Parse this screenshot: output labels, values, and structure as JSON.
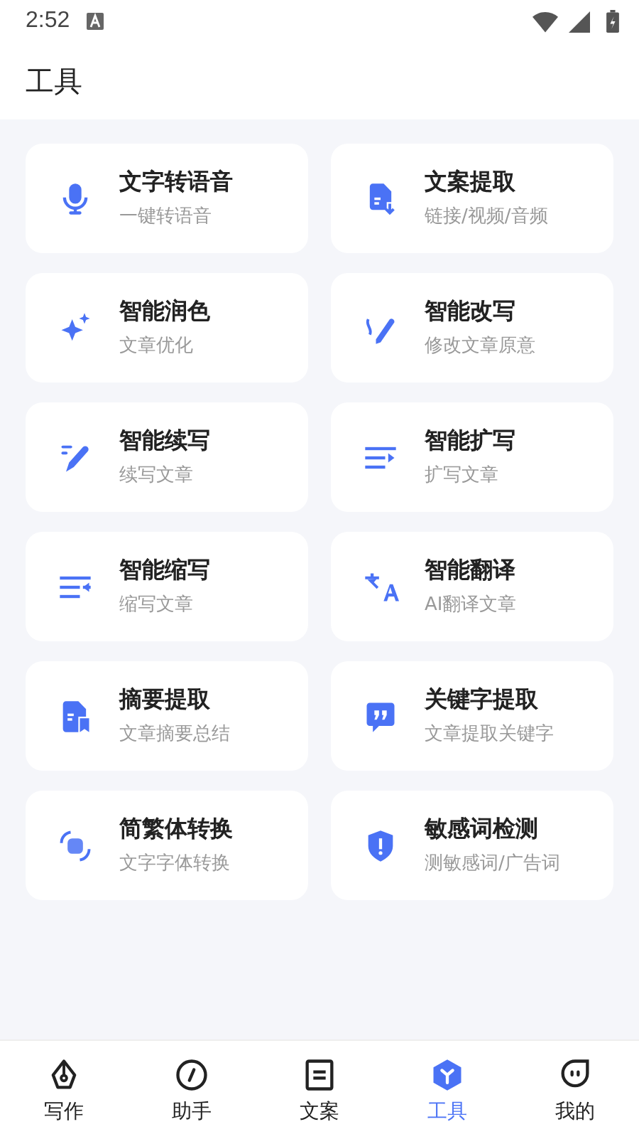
{
  "status_bar": {
    "time": "2:52"
  },
  "header": {
    "title": "工具"
  },
  "tools": [
    {
      "title": "文字转语音",
      "subtitle": "一键转语音"
    },
    {
      "title": "文案提取",
      "subtitle": "链接/视频/音频"
    },
    {
      "title": "智能润色",
      "subtitle": "文章优化"
    },
    {
      "title": "智能改写",
      "subtitle": "修改文章原意"
    },
    {
      "title": "智能续写",
      "subtitle": "续写文章"
    },
    {
      "title": "智能扩写",
      "subtitle": "扩写文章"
    },
    {
      "title": "智能缩写",
      "subtitle": "缩写文章"
    },
    {
      "title": "智能翻译",
      "subtitle": "AI翻译文章"
    },
    {
      "title": "摘要提取",
      "subtitle": "文章摘要总结"
    },
    {
      "title": "关键字提取",
      "subtitle": "文章提取关键字"
    },
    {
      "title": "简繁体转换",
      "subtitle": "文字字体转换"
    },
    {
      "title": "敏感词检测",
      "subtitle": "测敏感词/广告词"
    }
  ],
  "tabs": [
    {
      "label": "写作",
      "selected": false
    },
    {
      "label": "助手",
      "selected": false
    },
    {
      "label": "文案",
      "selected": false
    },
    {
      "label": "工具",
      "selected": true
    },
    {
      "label": "我的",
      "selected": false
    }
  ]
}
